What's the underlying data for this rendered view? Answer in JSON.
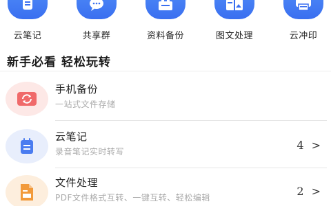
{
  "quick_actions": [
    {
      "label": "云笔记",
      "icon": "note-icon"
    },
    {
      "label": "共享群",
      "icon": "chat-bubble-icon"
    },
    {
      "label": "资料备份",
      "icon": "backup-icon"
    },
    {
      "label": "图文处理",
      "icon": "image-text-icon"
    },
    {
      "label": "云冲印",
      "icon": "printer-icon"
    }
  ],
  "section": {
    "title": "新手必看 轻松玩转"
  },
  "guides": [
    {
      "title": "手机备份",
      "subtitle": "一站式文件存储",
      "count": "",
      "icon": "phone-backup-icon",
      "color": "#f06a6a",
      "bg": "#fde8e6"
    },
    {
      "title": "云笔记",
      "subtitle": "录音笔记实时转写",
      "count": "4 >",
      "icon": "cloud-note-icon",
      "color": "#4a7cf0",
      "bg": "#e8eefc"
    },
    {
      "title": "文件处理",
      "subtitle": "PDF文件格式互转、一键互转、轻松编辑",
      "count": "2 >",
      "icon": "file-process-icon",
      "color": "#f29a3a",
      "bg": "#fdeedd"
    }
  ]
}
